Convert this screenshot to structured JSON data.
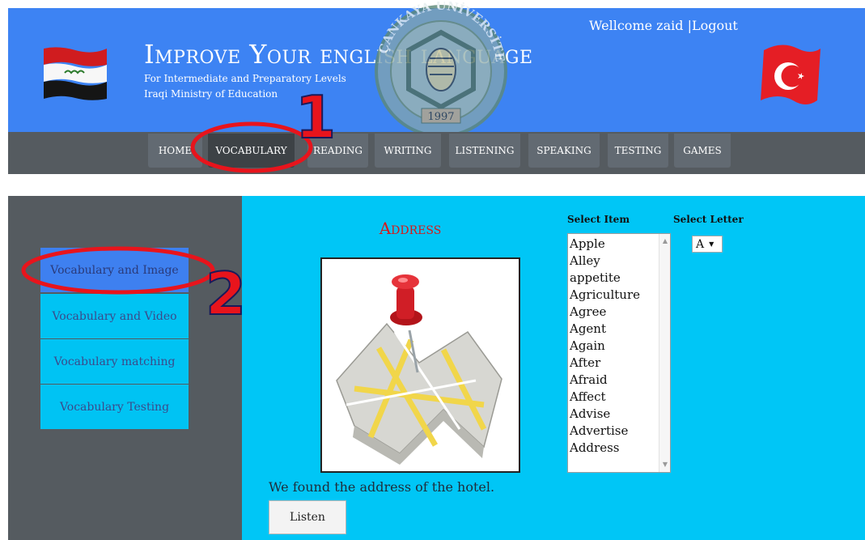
{
  "header": {
    "title": "Improve Your english language",
    "subtitle_line1": "For Intermediate and Preparatory Levels",
    "subtitle_line2": "Iraqi Ministry of Education",
    "logo_text": "ÇANKAYA ÜNİVERSİTESİ",
    "logo_year": "1997",
    "welcome_text": "Wellcome zaid |",
    "logout_label": "Logout"
  },
  "nav": {
    "items": [
      {
        "label": "HOME"
      },
      {
        "label": "VOCABULARY"
      },
      {
        "label": "READING"
      },
      {
        "label": "WRITING"
      },
      {
        "label": "LISTENING"
      },
      {
        "label": "SPEAKING"
      },
      {
        "label": "TESTING"
      },
      {
        "label": "GAMES"
      }
    ],
    "active": "VOCABULARY"
  },
  "sidebar": {
    "items": [
      {
        "label": "Vocabulary and Image"
      },
      {
        "label": "Vocabulary and Video"
      },
      {
        "label": "Vocabulary matching"
      },
      {
        "label": "Vocabulary Testing"
      }
    ],
    "active": "Vocabulary and Image"
  },
  "main": {
    "word": "Address",
    "example_sentence": "We found the address of the hotel.",
    "listen_label": "Listen",
    "select_item_label": "Select Item",
    "select_letter_label": "Select Letter",
    "selected_letter": "A",
    "items": [
      "Apple",
      "Alley",
      "appetite",
      "Agriculture",
      "Agree",
      "Agent",
      "Again",
      "After",
      "Afraid",
      "Affect",
      "Advise",
      "Advertise",
      "Address"
    ]
  },
  "annotations": {
    "marker1": "1",
    "marker2": "2",
    "color": "#e8141c"
  },
  "colors": {
    "header_bg": "#3d83f3",
    "nav_bg": "#555b60",
    "main_bg": "#00c6f6",
    "sidebar_item_bg": "#00c3f3",
    "word_title": "#d81818"
  }
}
